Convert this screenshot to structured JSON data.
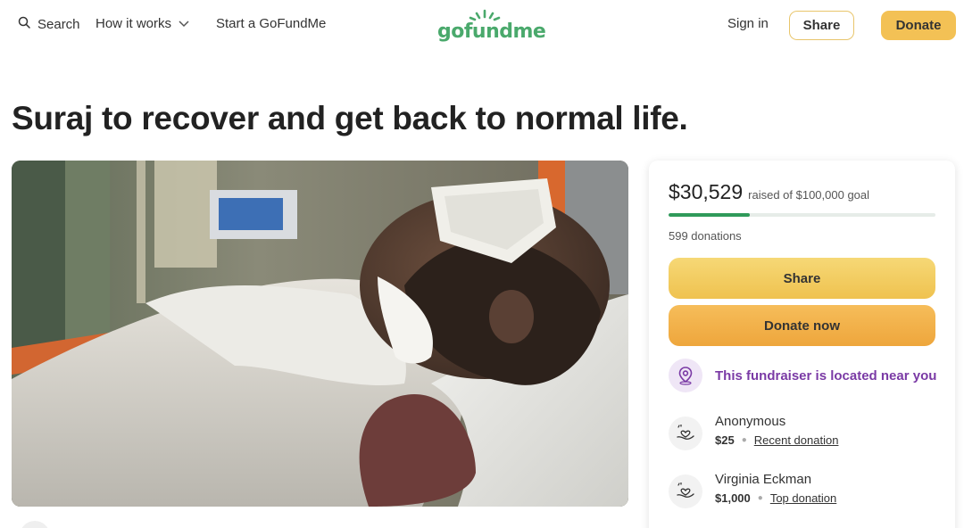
{
  "header": {
    "search_label": "Search",
    "how_it_works_label": "How it works",
    "start_label": "Start a GoFundMe",
    "logo_text": "gofundme",
    "sign_in_label": "Sign in",
    "share_label": "Share",
    "donate_label": "Donate"
  },
  "campaign": {
    "title": "Suraj to recover and get back to normal life."
  },
  "sidebar": {
    "raised_amount": "$30,529",
    "raised_goal_text": "raised of $100,000 goal",
    "progress_fraction": 0.305,
    "donations_count_text": "599 donations",
    "share_button_label": "Share",
    "donate_now_button_label": "Donate now",
    "location_text": "This fundraiser is located near you",
    "donations": [
      {
        "name": "Anonymous",
        "amount": "$25",
        "type": "Recent donation"
      },
      {
        "name": "Virginia Eckman",
        "amount": "$1,000",
        "type": "Top donation"
      }
    ]
  },
  "colors": {
    "brand_green": "#2f9a5a",
    "accent_yellow": "#f3c155",
    "accent_orange": "#eea63c",
    "location_purple": "#7a3aa5"
  },
  "icons": [
    "search-icon",
    "chevron-down-icon",
    "location-pin-icon",
    "donation-hand-heart-icon"
  ]
}
